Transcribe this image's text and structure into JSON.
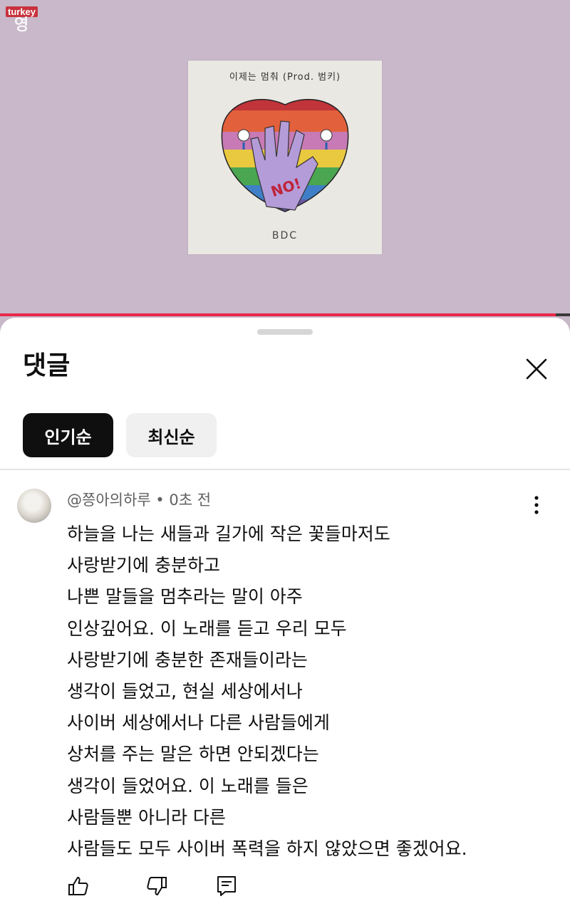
{
  "watermark": {
    "top": "turkey",
    "bottom": "영"
  },
  "cover": {
    "title": "이제는 멈춰 (Prod. 범키)",
    "hand_text": "NO!",
    "footer": "BDC"
  },
  "sheet": {
    "title": "댓글",
    "close_icon": "close-icon"
  },
  "sort_chips": [
    {
      "label": "인기순",
      "active": true
    },
    {
      "label": "최신순",
      "active": false
    }
  ],
  "comment": {
    "author": "@쯩아의하루",
    "separator": "•",
    "time": "0초 전",
    "lines": [
      "하늘을 나는 새들과 길가에 작은 꽃들마저도",
      "사랑받기에 충분하고",
      "나쁜 말들을 멈추라는 말이 아주",
      "인상깊어요. 이 노래를 듣고 우리 모두",
      "사랑받기에 충분한 존재들이라는",
      "생각이 들었고, 현실 세상에서나",
      "사이버 세상에서나 다른 사람들에게",
      "상처를 주는 말은 하면 안되겠다는",
      "생각이 들었어요. 이 노래를 들은",
      "사람들뿐 아니라 다른",
      "사람들도 모두 사이버 폭력을 하지 않았으면 좋겠어요."
    ],
    "actions": [
      "thumbs-up-icon",
      "thumbs-down-icon",
      "reply-icon"
    ]
  },
  "colors": {
    "background": "#c8b8c9",
    "progress": "#e8294a",
    "chip_active": "#0f0f0f"
  }
}
